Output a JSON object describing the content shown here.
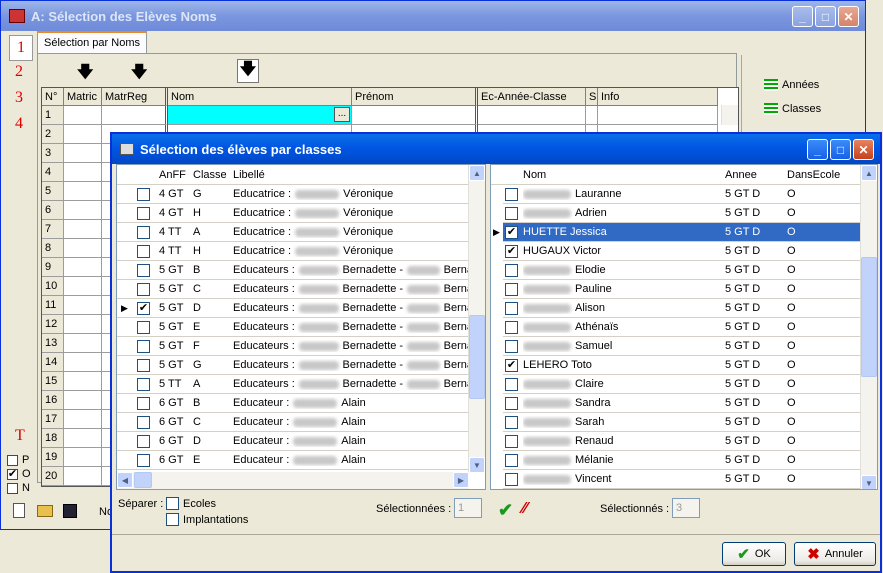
{
  "main_window": {
    "title": "A: Sélection des Elèves Noms",
    "tab": "Sélection par Noms",
    "steps": [
      "1",
      "2",
      "3",
      "4"
    ],
    "grid_headers": [
      "N°",
      "Matric",
      "MatrReg",
      "Nom",
      "Prénom",
      "Ec-Année-Classe",
      "S",
      "Info"
    ],
    "row_numbers": [
      "1",
      "2",
      "3",
      "4",
      "5",
      "6",
      "7",
      "8",
      "9",
      "10",
      "11",
      "12",
      "13",
      "14",
      "15",
      "16",
      "17",
      "18",
      "19",
      "20"
    ],
    "edit_button": "...",
    "right_panel": {
      "annees": "Années",
      "classes": "Classes"
    },
    "t_label": "T",
    "filters": [
      {
        "label": "P",
        "checked": false
      },
      {
        "label": "O",
        "checked": true
      },
      {
        "label": "N",
        "checked": false
      }
    ],
    "bottom_label": "No"
  },
  "dialog": {
    "title": "Sélection des élèves par classes",
    "left_headers": [
      "AnFF",
      "Classe",
      "Libellé"
    ],
    "classes": [
      {
        "anff": "4 GT",
        "classe": "G",
        "role": "Educatrice :",
        "name": "Véronique",
        "sel": false,
        "current": false
      },
      {
        "anff": "4 GT",
        "classe": "H",
        "role": "Educatrice :",
        "name": "Véronique",
        "sel": false,
        "current": false
      },
      {
        "anff": "4 TT",
        "classe": "A",
        "role": "Educatrice :",
        "name": "Véronique",
        "sel": false,
        "current": false
      },
      {
        "anff": "4 TT",
        "classe": "H",
        "role": "Educatrice :",
        "name": "Véronique",
        "sel": false,
        "current": false
      },
      {
        "anff": "5 GT",
        "classe": "B",
        "role": "Educateurs :",
        "name": "Bernadette -",
        "name2": "Berna",
        "sel": false,
        "current": false
      },
      {
        "anff": "5 GT",
        "classe": "C",
        "role": "Educateurs :",
        "name": "Bernadette -",
        "name2": "Berna",
        "sel": false,
        "current": false
      },
      {
        "anff": "5 GT",
        "classe": "D",
        "role": "Educateurs :",
        "name": "Bernadette -",
        "name2": "Berna",
        "sel": true,
        "current": true
      },
      {
        "anff": "5 GT",
        "classe": "E",
        "role": "Educateurs :",
        "name": "Bernadette -",
        "name2": "Berna",
        "sel": false,
        "current": false
      },
      {
        "anff": "5 GT",
        "classe": "F",
        "role": "Educateurs :",
        "name": "Bernadette -",
        "name2": "Berna",
        "sel": false,
        "current": false
      },
      {
        "anff": "5 GT",
        "classe": "G",
        "role": "Educateurs :",
        "name": "Bernadette -",
        "name2": "Berna",
        "sel": false,
        "current": false
      },
      {
        "anff": "5 TT",
        "classe": "A",
        "role": "Educateurs :",
        "name": "Bernadette -",
        "name2": "Berna",
        "sel": false,
        "current": false
      },
      {
        "anff": "6 GT",
        "classe": "B",
        "role": "Educateur :",
        "name": "Alain",
        "sel": false,
        "current": false
      },
      {
        "anff": "6 GT",
        "classe": "C",
        "role": "Educateur :",
        "name": "Alain",
        "sel": false,
        "current": false
      },
      {
        "anff": "6 GT",
        "classe": "D",
        "role": "Educateur :",
        "name": "Alain",
        "sel": false,
        "current": false
      },
      {
        "anff": "6 GT",
        "classe": "E",
        "role": "Educateur :",
        "name": "Alain",
        "sel": false,
        "current": false
      }
    ],
    "right_headers": [
      "Nom",
      "Annee",
      "DansEcole"
    ],
    "students": [
      {
        "first": "Lauranne",
        "annee": "5 GT D",
        "ecole": "O",
        "sel": false,
        "hl": false,
        "blur": true
      },
      {
        "first": "Adrien",
        "annee": "5 GT D",
        "ecole": "O",
        "sel": false,
        "hl": false,
        "blur": true
      },
      {
        "first": "HUETTE Jessica",
        "annee": "5 GT D",
        "ecole": "O",
        "sel": true,
        "hl": true,
        "blur": false
      },
      {
        "first": "HUGAUX Victor",
        "annee": "5 GT D",
        "ecole": "O",
        "sel": true,
        "hl": false,
        "blur": false
      },
      {
        "first": "Elodie",
        "annee": "5 GT D",
        "ecole": "O",
        "sel": false,
        "hl": false,
        "blur": true
      },
      {
        "first": "Pauline",
        "annee": "5 GT D",
        "ecole": "O",
        "sel": false,
        "hl": false,
        "blur": true
      },
      {
        "first": "Alison",
        "annee": "5 GT D",
        "ecole": "O",
        "sel": false,
        "hl": false,
        "blur": true
      },
      {
        "first": "Athénaïs",
        "annee": "5 GT D",
        "ecole": "O",
        "sel": false,
        "hl": false,
        "blur": true
      },
      {
        "first": "Samuel",
        "annee": "5 GT D",
        "ecole": "O",
        "sel": false,
        "hl": false,
        "blur": true
      },
      {
        "first": "LEHERO Toto",
        "annee": "5 GT D",
        "ecole": "O",
        "sel": true,
        "hl": false,
        "blur": false
      },
      {
        "first": "Claire",
        "annee": "5 GT D",
        "ecole": "O",
        "sel": false,
        "hl": false,
        "blur": true
      },
      {
        "first": "Sandra",
        "annee": "5 GT D",
        "ecole": "O",
        "sel": false,
        "hl": false,
        "blur": true
      },
      {
        "first": "Sarah",
        "annee": "5 GT D",
        "ecole": "O",
        "sel": false,
        "hl": false,
        "blur": true
      },
      {
        "first": "Renaud",
        "annee": "5 GT D",
        "ecole": "O",
        "sel": false,
        "hl": false,
        "blur": true
      },
      {
        "first": "Mélanie",
        "annee": "5 GT D",
        "ecole": "O",
        "sel": false,
        "hl": false,
        "blur": true
      },
      {
        "first": "Vincent",
        "annee": "5 GT D",
        "ecole": "O",
        "sel": false,
        "hl": false,
        "blur": true
      }
    ],
    "separer_label": "Séparer :",
    "ecoles_label": "Ecoles",
    "implantations_label": "Implantations",
    "selectionnees_label": "Sélectionnées :",
    "selectionnees_value": "1",
    "selectionnes_label": "Sélectionnés :",
    "selectionnes_value": "3",
    "ok_label": "OK",
    "cancel_label": "Annuler"
  },
  "colors": {
    "accent": "#316ac5",
    "cyan": "#00ffff",
    "title_blue": "#0054e3"
  }
}
